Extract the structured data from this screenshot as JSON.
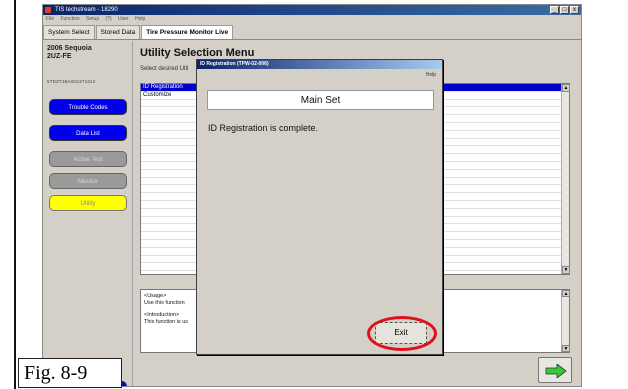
{
  "window": {
    "title": "TIS techstream - 18290",
    "controls": [
      "_",
      "□",
      "x"
    ]
  },
  "menubar": [
    "File",
    "Function",
    "Setup",
    "(?)",
    "User",
    "Help"
  ],
  "tabs": [
    {
      "label": "System Select",
      "active": false
    },
    {
      "label": "Stored Data",
      "active": false
    },
    {
      "label": "Tire Pressure Monitor Live",
      "active": true
    }
  ],
  "vehicle": {
    "model": "2006 Sequoia",
    "engine": "2UZ-FE",
    "vin": "5TDZT38A06S271612"
  },
  "sidebar": {
    "buttons": [
      {
        "label": "Trouble Codes",
        "state": "active"
      },
      {
        "label": "Data List",
        "state": "active"
      },
      {
        "label": "Active Test",
        "state": "disabled"
      },
      {
        "label": "Monitor",
        "state": "disabled"
      },
      {
        "label": "Utility",
        "state": "selected"
      }
    ]
  },
  "main": {
    "heading": "Utility Selection Menu",
    "subheading": "Select desired Util",
    "list": [
      {
        "label": "ID Registration",
        "selected": true
      },
      {
        "label": "Customize",
        "selected": false
      }
    ],
    "info": {
      "usage_title": "<Usage>",
      "usage_text": "Use this function",
      "intro_title": "<Introduction>",
      "intro_text": "This function is us"
    }
  },
  "dialog": {
    "title": "ID Registration (TPW-02-006)",
    "help": "Help",
    "header": "Main Set",
    "message": "ID Registration is complete.",
    "exit_label": "Exit"
  },
  "figure_label": "Fig. 8-9",
  "colors": {
    "sidebar_button_active": "#0000ee",
    "utility_button": "#ffff00",
    "selected_row": "#0000cc",
    "highlight_ring": "#e0101a",
    "forward_arrow": "#33cc33"
  },
  "icons": {
    "forward": "forward-arrow-icon",
    "app": "app-icon"
  }
}
